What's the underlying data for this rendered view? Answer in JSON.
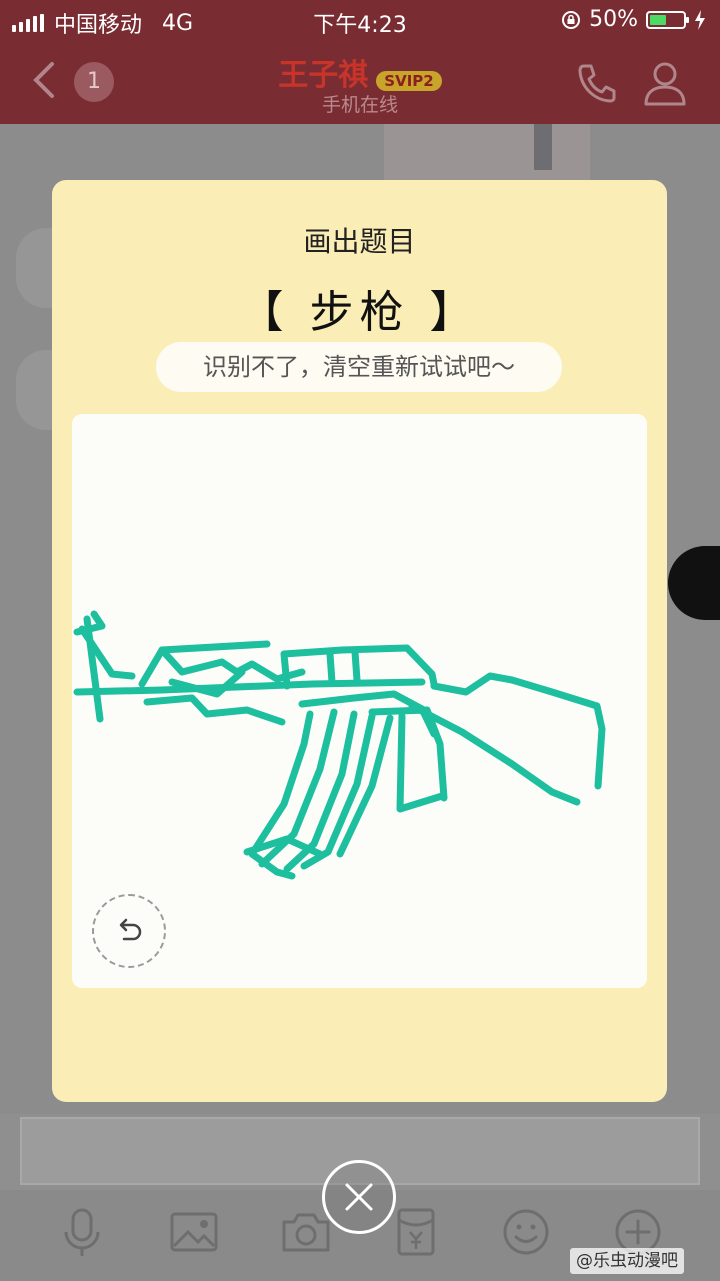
{
  "status_bar": {
    "carrier": "中国移动",
    "network": "4G",
    "time": "下午4:23",
    "battery": "50%",
    "battery_level": 0.5
  },
  "chat_header": {
    "unread_count": "1",
    "contact_name": "王子祺",
    "vip_badge": "SVIP2",
    "contact_status": "手机在线"
  },
  "modal": {
    "title": "画出题目",
    "word": "【 步枪 】",
    "hint": "识别不了，清空重新试试吧～",
    "stroke_color": "#1dbf9f",
    "background_color": "#faedb6"
  },
  "toolbar": {
    "icons": [
      "microphone-icon",
      "image-icon",
      "camera-icon",
      "red-packet-icon",
      "emoji-icon",
      "plus-icon"
    ]
  },
  "watermark": "@乐虫动漫吧"
}
